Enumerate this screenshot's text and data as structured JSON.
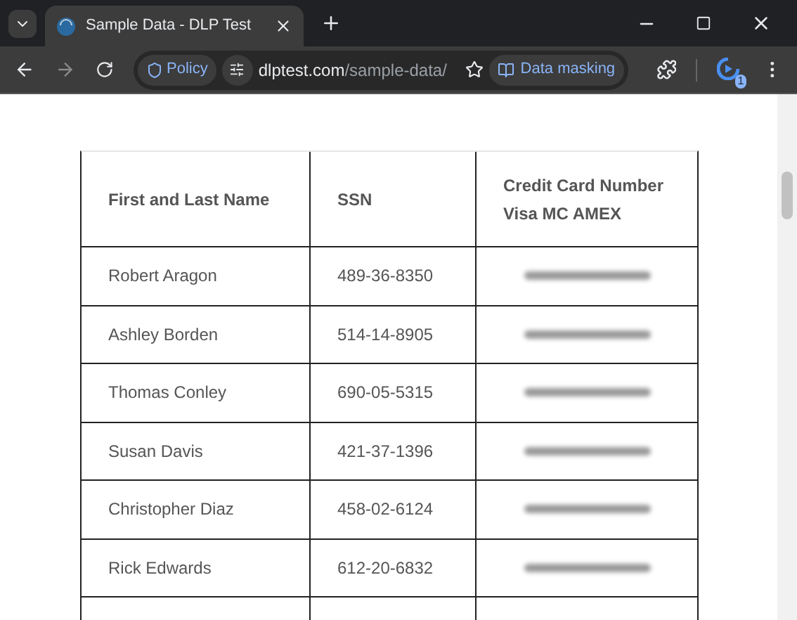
{
  "tab_strip": {
    "tabs": [
      {
        "title": "Sample Data - DLP Test",
        "selected": true
      }
    ]
  },
  "toolbar": {
    "policy_chip": "Policy",
    "url_domain": "dlptest.com",
    "url_path": "/sample-data/",
    "masking_chip": "Data masking",
    "extension_badge": "1"
  },
  "table": {
    "columns": [
      "First and Last Name",
      "SSN",
      "Credit Card Number\nVisa MC AMEX"
    ],
    "rows": [
      {
        "name": "Robert Aragon",
        "ssn": "489-36-8350",
        "card_masked": true
      },
      {
        "name": "Ashley Borden",
        "ssn": "514-14-8905",
        "card_masked": true
      },
      {
        "name": "Thomas Conley",
        "ssn": "690-05-5315",
        "card_masked": true
      },
      {
        "name": "Susan Davis",
        "ssn": "421-37-1396",
        "card_masked": true
      },
      {
        "name": "Christopher Diaz",
        "ssn": "458-02-6124",
        "card_masked": true
      },
      {
        "name": "Rick Edwards",
        "ssn": "612-20-6832",
        "card_masked": true
      }
    ]
  }
}
